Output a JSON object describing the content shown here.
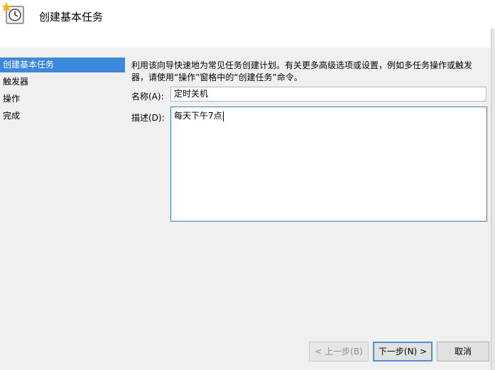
{
  "header": {
    "title": "创建基本任务",
    "icon": "task-scheduler-icon"
  },
  "sidebar": {
    "items": [
      {
        "label": "创建基本任务",
        "active": true
      },
      {
        "label": "触发器",
        "active": false
      },
      {
        "label": "操作",
        "active": false
      },
      {
        "label": "完成",
        "active": false
      }
    ]
  },
  "main": {
    "description": "利用该向导快速地为常见任务创建计划。有关更多高级选项或设置，例如多任务操作或触发器，请使用“操作”窗格中的“创建任务”命令。",
    "name_label": "名称(A):",
    "name_value": "定时关机",
    "desc_label": "描述(D):",
    "desc_value": "每天下午7点"
  },
  "buttons": {
    "back": "< 上一步(B)",
    "next": "下一步(N) >",
    "cancel": "取消"
  },
  "colors": {
    "accent": "#3c88dc",
    "selection_border": "#4f8fd6"
  }
}
